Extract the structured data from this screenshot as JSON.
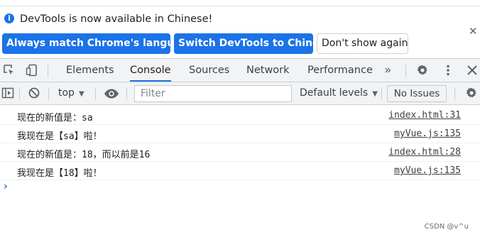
{
  "infobar": {
    "message": "DevTools is now available in Chinese!",
    "btn_match": "Always match Chrome's language",
    "btn_switch": "Switch DevTools to Chinese",
    "btn_dismiss": "Don't show again",
    "close_glyph": "✕"
  },
  "tabs": [
    "Elements",
    "Console",
    "Sources",
    "Network",
    "Performance"
  ],
  "active_tab": "Console",
  "overflow_glyph": "»",
  "console_toolbar": {
    "context": "top",
    "filter_placeholder": "Filter",
    "levels": "Default levels",
    "issues": "No Issues"
  },
  "logs": [
    {
      "message": "现在的新值是：sa",
      "source": "index.html:31"
    },
    {
      "message": "我现在是【sa】啦！",
      "source": "myVue.js:135"
    },
    {
      "message": "现在的新值是：18，而以前是16",
      "source": "index.html:28"
    },
    {
      "message": "我现在是【18】啦！",
      "source": "myVue.js:135"
    }
  ],
  "watermark": "CSDN @v^u",
  "icons": [
    "info-icon",
    "inspect-icon",
    "device-toggle-icon",
    "gear-icon",
    "kebab-menu-icon",
    "close-icon",
    "sidebar-toggle-icon",
    "clear-console-icon",
    "eye-icon",
    "settings-icon",
    "prompt-chevron-icon"
  ],
  "colors": {
    "accent": "#1a73e8",
    "toolbar_bg": "#f1f3f4",
    "border": "#cbcdd1"
  }
}
